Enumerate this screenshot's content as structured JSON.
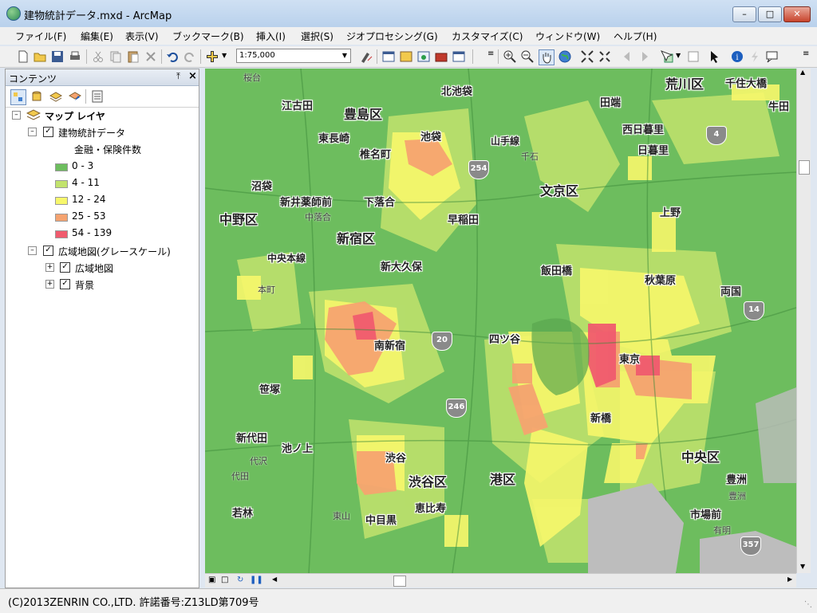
{
  "window": {
    "title": "建物統計データ.mxd - ArcMap"
  },
  "menu": [
    "ファイル(F)",
    "編集(E)",
    "表示(V)",
    "ブックマーク(B)",
    "挿入(I)",
    "選択(S)",
    "ジオプロセシング(G)",
    "カスタマイズ(C)",
    "ウィンドウ(W)",
    "ヘルプ(H)"
  ],
  "toolbar": {
    "scale": "1:75,000"
  },
  "toc": {
    "title": "コンテンツ",
    "root": "マップ レイヤ",
    "layer1": "建物統計データ",
    "field": "金融・保険件数",
    "legend": [
      {
        "label": "0 - 3",
        "color": "#6dbd5e"
      },
      {
        "label": "4 - 11",
        "color": "#c2e36d"
      },
      {
        "label": "12 - 24",
        "color": "#f7f76b"
      },
      {
        "label": "25 - 53",
        "color": "#f5a370"
      },
      {
        "label": "54 - 139",
        "color": "#f05b6e"
      }
    ],
    "layer2": "広域地図(グレースケール)",
    "sublayer1": "広域地図",
    "sublayer2": "背景"
  },
  "map": {
    "wards": [
      "豊島区",
      "文京区",
      "荒川区",
      "中野区",
      "新宿区",
      "渋谷区",
      "港区",
      "中央区"
    ],
    "stations": [
      "北池袋",
      "田端",
      "千住大橋",
      "牛田",
      "江古田",
      "東長崎",
      "池袋",
      "西日暮里",
      "日暮里",
      "椎名町",
      "山手線",
      "沼袋",
      "新井薬師前",
      "下落合",
      "上野",
      "早稲田",
      "中央本線",
      "新大久保",
      "飯田橋",
      "秋葉原",
      "両国",
      "南新宿",
      "四ツ谷",
      "東京",
      "笹塚",
      "新橋",
      "新代田",
      "池ノ上",
      "渋谷",
      "恵比寿",
      "若林",
      "中目黒",
      "豊洲",
      "市場前"
    ],
    "faint": [
      "桜台",
      "千石",
      "中落合",
      "本町",
      "代沢",
      "代田",
      "東山",
      "有明",
      "豊洲"
    ],
    "routes": [
      "4",
      "254",
      "14",
      "20",
      "246",
      "357"
    ]
  },
  "status": {
    "text": "(C)2013ZENRIN CO.,LTD. 許諾番号:Z13LD第709号"
  }
}
